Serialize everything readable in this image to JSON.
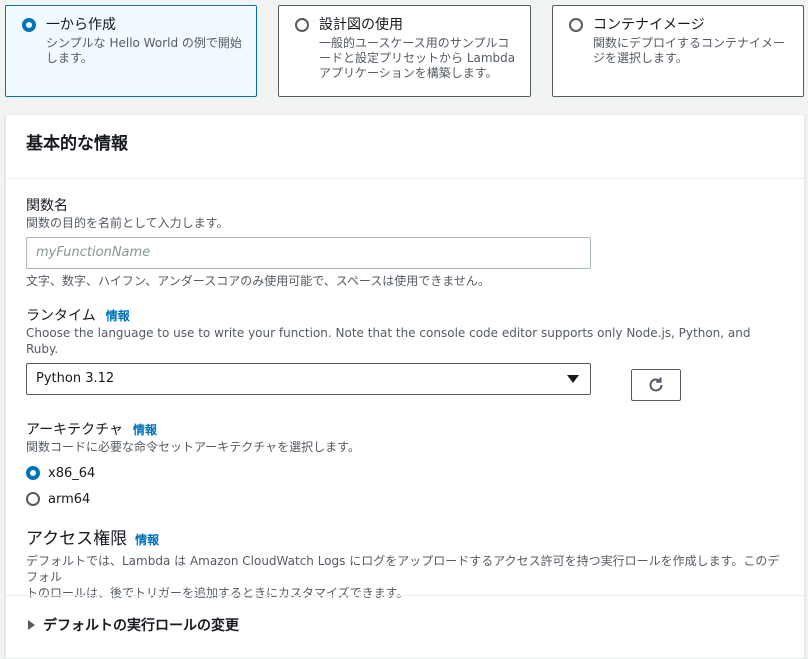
{
  "options": [
    {
      "title": "一から作成",
      "desc_lines": [
        "シンプルな Hello World の例で開始",
        "します。"
      ]
    },
    {
      "title": "設計図の使用",
      "desc_lines": [
        "一般的ユースケース用のサンプルコ",
        "ードと設定プリセットから Lambda",
        "アプリケーションを構築します。"
      ]
    },
    {
      "title": "コンテナイメージ",
      "desc_lines": [
        "関数にデプロイするコンテナイメー",
        "ジを選択します。"
      ]
    }
  ],
  "basic": {
    "header": "基本的な情報",
    "function_name": {
      "label": "関数名",
      "desc": "関数の目的を名前として入力します。",
      "placeholder": "myFunctionName",
      "constraint": "文字、数字、ハイフン、アンダースコアのみ使用可能で、スペースは使用できません。"
    },
    "runtime": {
      "label": "ランタイム",
      "info": "情報",
      "desc": "Choose the language to use to write your function. Note that the console code editor supports only Node.js, Python, and Ruby.",
      "value": "Python 3.12"
    },
    "architecture": {
      "label": "アーキテクチャ",
      "info": "情報",
      "desc": "関数コードに必要な命令セットアーキテクチャを選択します。",
      "options": [
        "x86_64",
        "arm64"
      ]
    },
    "permissions": {
      "title": "アクセス権限",
      "info": "情報",
      "desc_lines": [
        "デフォルトでは、Lambda は Amazon CloudWatch Logs にログをアップロードするアクセス許可を持つ実行ロールを作成します。このデフォル",
        "トのロールは、後でトリガーを追加するときにカスタマイズできます。"
      ]
    },
    "expander": "デフォルトの実行ロールの変更"
  },
  "colors": {
    "accent": "#0073bb",
    "text": "#16191f",
    "muted": "#545b64"
  },
  "icons": {
    "refresh": "refresh-icon",
    "expand": "caret-right-icon"
  }
}
